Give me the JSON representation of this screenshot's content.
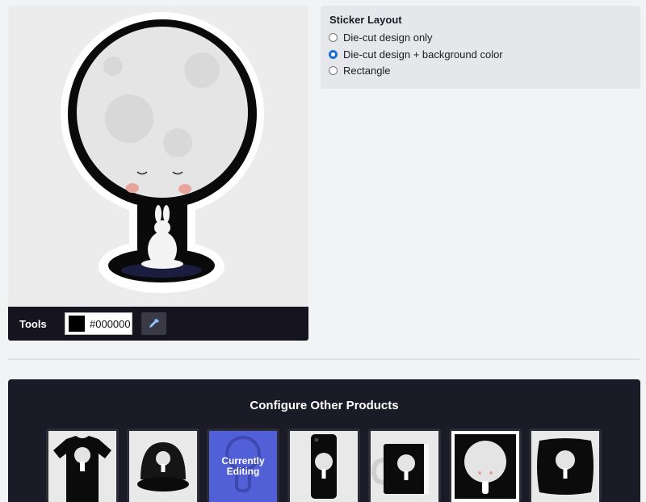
{
  "tools": {
    "label": "Tools",
    "color_value": "#000000",
    "swatch_color": "#000000"
  },
  "sticker_layout": {
    "title": "Sticker Layout",
    "options": [
      {
        "label": "Die-cut design only",
        "selected": false
      },
      {
        "label": "Die-cut design + background color",
        "selected": true
      },
      {
        "label": "Rectangle",
        "selected": false
      }
    ]
  },
  "configure": {
    "title": "Configure Other Products",
    "products": [
      {
        "name": "t-shirt",
        "icon": "tshirt-icon"
      },
      {
        "name": "cap",
        "icon": "cap-icon"
      },
      {
        "name": "sticker",
        "editing_label": "Currently Editing"
      },
      {
        "name": "phone-case",
        "icon": "phone-case-icon"
      },
      {
        "name": "mug",
        "icon": "mug-icon"
      },
      {
        "name": "poster",
        "icon": "poster-icon"
      },
      {
        "name": "pillow",
        "icon": "pillow-icon"
      }
    ]
  },
  "colors": {
    "accent": "#1a6fd6",
    "editing": "#5160d6",
    "dark_panel": "#1b1a27"
  }
}
